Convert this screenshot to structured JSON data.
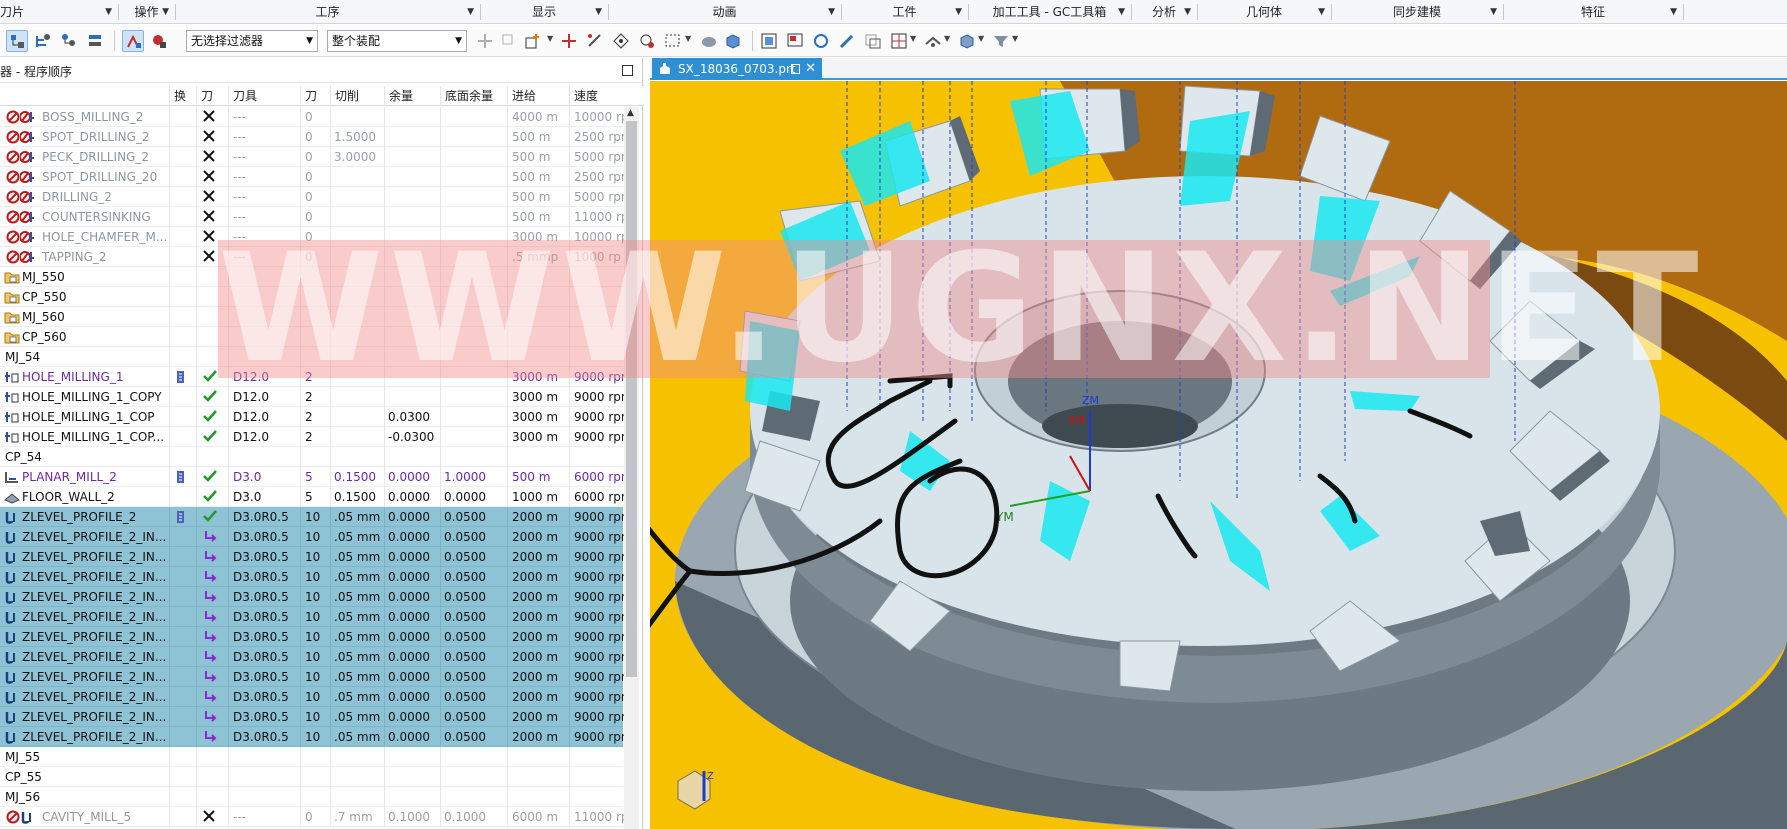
{
  "ribbon": {
    "groups": [
      "刀片",
      "操作",
      "工序",
      "显示",
      "动画",
      "工件",
      "加工工具 - GC工具箱",
      "分析",
      "几何体",
      "同步建模",
      "特征"
    ]
  },
  "toolbar": {
    "filter_select": "无选择过滤器",
    "assembly_select": "整个装配"
  },
  "navigator": {
    "title": "器 - 程序顺序",
    "columns": [
      "换",
      "刀",
      "刀具",
      "刀",
      "切削",
      "余量",
      "底面余量",
      "进给",
      "速度"
    ],
    "rows": [
      {
        "name": "BOSS_MILLING_2",
        "status": "x",
        "tool": "---",
        "num": "0",
        "cut": "",
        "stock": "",
        "floor": "",
        "feed": "4000 m",
        "speed": "10000 rp",
        "style": "disabled",
        "icon": "drill"
      },
      {
        "name": "SPOT_DRILLING_2",
        "status": "x",
        "tool": "---",
        "num": "0",
        "cut": "1.5000",
        "stock": "",
        "floor": "",
        "feed": "500 m",
        "speed": "2500 rpn",
        "style": "disabled",
        "icon": "drill"
      },
      {
        "name": "PECK_DRILLING_2",
        "status": "x",
        "tool": "---",
        "num": "0",
        "cut": "3.0000",
        "stock": "",
        "floor": "",
        "feed": "500 m",
        "speed": "5000 rpn",
        "style": "disabled",
        "icon": "drill"
      },
      {
        "name": "SPOT_DRILLING_20",
        "status": "x",
        "tool": "---",
        "num": "0",
        "cut": "",
        "stock": "",
        "floor": "",
        "feed": "500 m",
        "speed": "2500 rpn",
        "style": "disabled",
        "icon": "drill"
      },
      {
        "name": "DRILLING_2",
        "status": "x",
        "tool": "---",
        "num": "0",
        "cut": "",
        "stock": "",
        "floor": "",
        "feed": "500 m",
        "speed": "5000 rpn",
        "style": "disabled",
        "icon": "drill"
      },
      {
        "name": "COUNTERSINKING",
        "status": "x",
        "tool": "---",
        "num": "0",
        "cut": "",
        "stock": "",
        "floor": "",
        "feed": "500 m",
        "speed": "11000 rp",
        "style": "disabled",
        "icon": "drill"
      },
      {
        "name": "HOLE_CHAMFER_M...",
        "status": "x",
        "tool": "---",
        "num": "0",
        "cut": "",
        "stock": "",
        "floor": "",
        "feed": "3000 m",
        "speed": "10000 rp",
        "style": "disabled",
        "icon": "drill"
      },
      {
        "name": "TAPPING_2",
        "status": "x",
        "tool": "---",
        "num": "0",
        "cut": "",
        "stock": "",
        "floor": "",
        "feed": ".5 mmp",
        "speed": "1000 rp",
        "style": "disabled",
        "icon": "drill"
      },
      {
        "name": "MJ_550",
        "style": "group",
        "icon": "folder"
      },
      {
        "name": "CP_550",
        "style": "group",
        "icon": "folder"
      },
      {
        "name": "MJ_560",
        "style": "group",
        "icon": "folder"
      },
      {
        "name": "CP_560",
        "style": "group",
        "icon": "folder"
      },
      {
        "name": "MJ_54",
        "style": "plain",
        "icon": "none"
      },
      {
        "name": "HOLE_MILLING_1",
        "status": "ok",
        "tool": "D12.0",
        "num": "2",
        "cut": "",
        "stock": "",
        "floor": "",
        "feed": "3000 m",
        "speed": "9000 rpn",
        "style": "purple",
        "icon": "mill",
        "change": true
      },
      {
        "name": "HOLE_MILLING_1_COPY",
        "status": "ok",
        "tool": "D12.0",
        "num": "2",
        "cut": "",
        "stock": "",
        "floor": "",
        "feed": "3000 m",
        "speed": "9000 rpn",
        "style": "normal",
        "icon": "mill"
      },
      {
        "name": "HOLE_MILLING_1_COP",
        "status": "ok",
        "tool": "D12.0",
        "num": "2",
        "cut": "",
        "stock": "0.0300",
        "floor": "",
        "feed": "3000 m",
        "speed": "9000 rpn",
        "style": "normal",
        "icon": "mill"
      },
      {
        "name": "HOLE_MILLING_1_COP...",
        "status": "ok",
        "tool": "D12.0",
        "num": "2",
        "cut": "",
        "stock": "-0.0300",
        "floor": "",
        "feed": "3000 m",
        "speed": "9000 rpn",
        "style": "normal",
        "icon": "mill"
      },
      {
        "name": "CP_54",
        "style": "plain",
        "icon": "none"
      },
      {
        "name": "PLANAR_MILL_2",
        "status": "ok",
        "tool": "D3.0",
        "num": "5",
        "cut": "0.1500",
        "stock": "0.0000",
        "floor": "1.0000",
        "feed": "500 m",
        "speed": "6000 rpn",
        "style": "purple",
        "icon": "planar",
        "change": true
      },
      {
        "name": "FLOOR_WALL_2",
        "status": "ok",
        "tool": "D3.0",
        "num": "5",
        "cut": "0.1500",
        "stock": "0.0000",
        "floor": "0.0000",
        "feed": "1000 m",
        "speed": "6000 rpn",
        "style": "normal",
        "icon": "floor"
      },
      {
        "name": "ZLEVEL_PROFILE_2",
        "status": "ok",
        "tool": "D3.0R0.5",
        "num": "10",
        "cut": ".05 mm",
        "stock": "0.0000",
        "floor": "0.0500",
        "feed": "2000 m",
        "speed": "9000 rpn",
        "style": "selected",
        "icon": "zlevel",
        "change": true
      },
      {
        "name": "ZLEVEL_PROFILE_2_IN...",
        "status": "redo",
        "tool": "D3.0R0.5",
        "num": "10",
        "cut": ".05 mm",
        "stock": "0.0000",
        "floor": "0.0500",
        "feed": "2000 m",
        "speed": "9000 rpn",
        "style": "selected",
        "icon": "zlevel"
      },
      {
        "name": "ZLEVEL_PROFILE_2_IN...",
        "status": "redo",
        "tool": "D3.0R0.5",
        "num": "10",
        "cut": ".05 mm",
        "stock": "0.0000",
        "floor": "0.0500",
        "feed": "2000 m",
        "speed": "9000 rpn",
        "style": "selected",
        "icon": "zlevel"
      },
      {
        "name": "ZLEVEL_PROFILE_2_IN...",
        "status": "redo",
        "tool": "D3.0R0.5",
        "num": "10",
        "cut": ".05 mm",
        "stock": "0.0000",
        "floor": "0.0500",
        "feed": "2000 m",
        "speed": "9000 rpn",
        "style": "selected",
        "icon": "zlevel"
      },
      {
        "name": "ZLEVEL_PROFILE_2_IN...",
        "status": "redo",
        "tool": "D3.0R0.5",
        "num": "10",
        "cut": ".05 mm",
        "stock": "0.0000",
        "floor": "0.0500",
        "feed": "2000 m",
        "speed": "9000 rpn",
        "style": "selected",
        "icon": "zlevel"
      },
      {
        "name": "ZLEVEL_PROFILE_2_IN...",
        "status": "redo",
        "tool": "D3.0R0.5",
        "num": "10",
        "cut": ".05 mm",
        "stock": "0.0000",
        "floor": "0.0500",
        "feed": "2000 m",
        "speed": "9000 rpn",
        "style": "selected",
        "icon": "zlevel"
      },
      {
        "name": "ZLEVEL_PROFILE_2_IN...",
        "status": "redo",
        "tool": "D3.0R0.5",
        "num": "10",
        "cut": ".05 mm",
        "stock": "0.0000",
        "floor": "0.0500",
        "feed": "2000 m",
        "speed": "9000 rpn",
        "style": "selected",
        "icon": "zlevel"
      },
      {
        "name": "ZLEVEL_PROFILE_2_IN...",
        "status": "redo",
        "tool": "D3.0R0.5",
        "num": "10",
        "cut": ".05 mm",
        "stock": "0.0000",
        "floor": "0.0500",
        "feed": "2000 m",
        "speed": "9000 rpn",
        "style": "selected",
        "icon": "zlevel"
      },
      {
        "name": "ZLEVEL_PROFILE_2_IN...",
        "status": "redo",
        "tool": "D3.0R0.5",
        "num": "10",
        "cut": ".05 mm",
        "stock": "0.0000",
        "floor": "0.0500",
        "feed": "2000 m",
        "speed": "9000 rpn",
        "style": "selected",
        "icon": "zlevel"
      },
      {
        "name": "ZLEVEL_PROFILE_2_IN...",
        "status": "redo",
        "tool": "D3.0R0.5",
        "num": "10",
        "cut": ".05 mm",
        "stock": "0.0000",
        "floor": "0.0500",
        "feed": "2000 m",
        "speed": "9000 rpn",
        "style": "selected",
        "icon": "zlevel"
      },
      {
        "name": "ZLEVEL_PROFILE_2_IN...",
        "status": "redo",
        "tool": "D3.0R0.5",
        "num": "10",
        "cut": ".05 mm",
        "stock": "0.0000",
        "floor": "0.0500",
        "feed": "2000 m",
        "speed": "9000 rpn",
        "style": "selected",
        "icon": "zlevel"
      },
      {
        "name": "ZLEVEL_PROFILE_2_IN...",
        "status": "redo",
        "tool": "D3.0R0.5",
        "num": "10",
        "cut": ".05 mm",
        "stock": "0.0000",
        "floor": "0.0500",
        "feed": "2000 m",
        "speed": "9000 rpn",
        "style": "selected",
        "icon": "zlevel"
      },
      {
        "name": "MJ_55",
        "style": "plain",
        "icon": "none"
      },
      {
        "name": "CP_55",
        "style": "plain",
        "icon": "none"
      },
      {
        "name": "MJ_56",
        "style": "plain",
        "icon": "none"
      },
      {
        "name": "CAVITY_MILL_5",
        "status": "x",
        "tool": "---",
        "num": "0",
        "cut": ".7 mm",
        "stock": "0.1000",
        "floor": "0.1000",
        "feed": "6000 m",
        "speed": "11000 rp",
        "style": "disabled",
        "icon": "zlevel"
      }
    ]
  },
  "graphics": {
    "file_tab": "SX_18036_0703.prt",
    "watermark": "WWW.UGNX.NET",
    "axis_labels": {
      "zm": "ZM",
      "xm": "XM",
      "ym": "YM",
      "z": "Z"
    },
    "colors": {
      "background": "#f6c200",
      "part": "#d6e3ea",
      "toolpath": "#19e8f0",
      "selection": "#8ec3d6"
    }
  }
}
